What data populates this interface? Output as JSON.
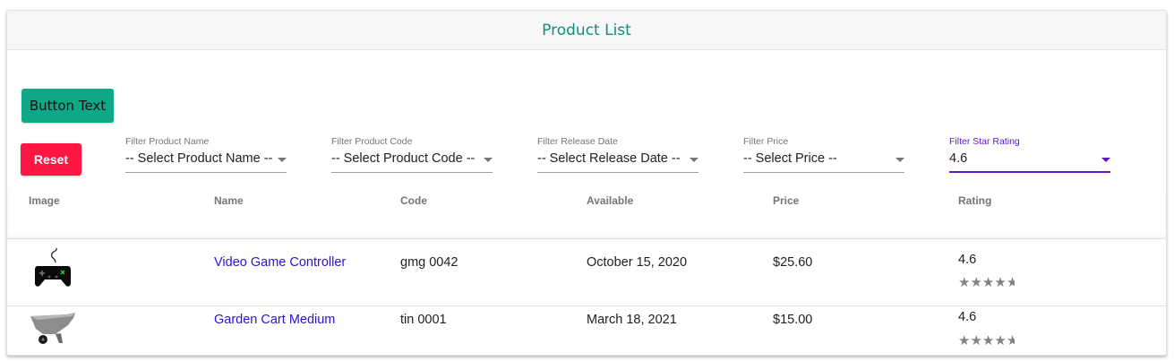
{
  "header": {
    "title": "Product List"
  },
  "toolbar": {
    "primary_button_label": "Button Text",
    "reset_label": "Reset"
  },
  "filters": [
    {
      "label": "Filter Product Name",
      "value": "-- Select Product Name --"
    },
    {
      "label": "Filter Product Code",
      "value": "-- Select Product Code --"
    },
    {
      "label": "Filter Release Date",
      "value": "-- Select Release Date --"
    },
    {
      "label": "Filter Price",
      "value": "-- Select Price --"
    },
    {
      "label": "Filter Star Rating",
      "value": "4.6"
    }
  ],
  "table": {
    "columns": [
      "Image",
      "Name",
      "Code",
      "Available",
      "Price",
      "Rating"
    ],
    "rows": [
      {
        "image_icon": "game-controller-icon",
        "name": "Video Game Controller",
        "code": "gmg 0042",
        "available": "October 15, 2020",
        "price": "$25.60",
        "rating": "4.6",
        "stars": 4.6
      },
      {
        "image_icon": "garden-cart-icon",
        "name": "Garden Cart Medium",
        "code": "tin 0001",
        "available": "March 18, 2021",
        "price": "$15.00",
        "rating": "4.6",
        "stars": 4.6
      }
    ]
  },
  "colors": {
    "accent": "#0ea886",
    "title": "#0f8f7c",
    "reset": "#ff1744",
    "active_filter": "#5e16c9",
    "link": "#2a12d9",
    "star": "#828282"
  }
}
